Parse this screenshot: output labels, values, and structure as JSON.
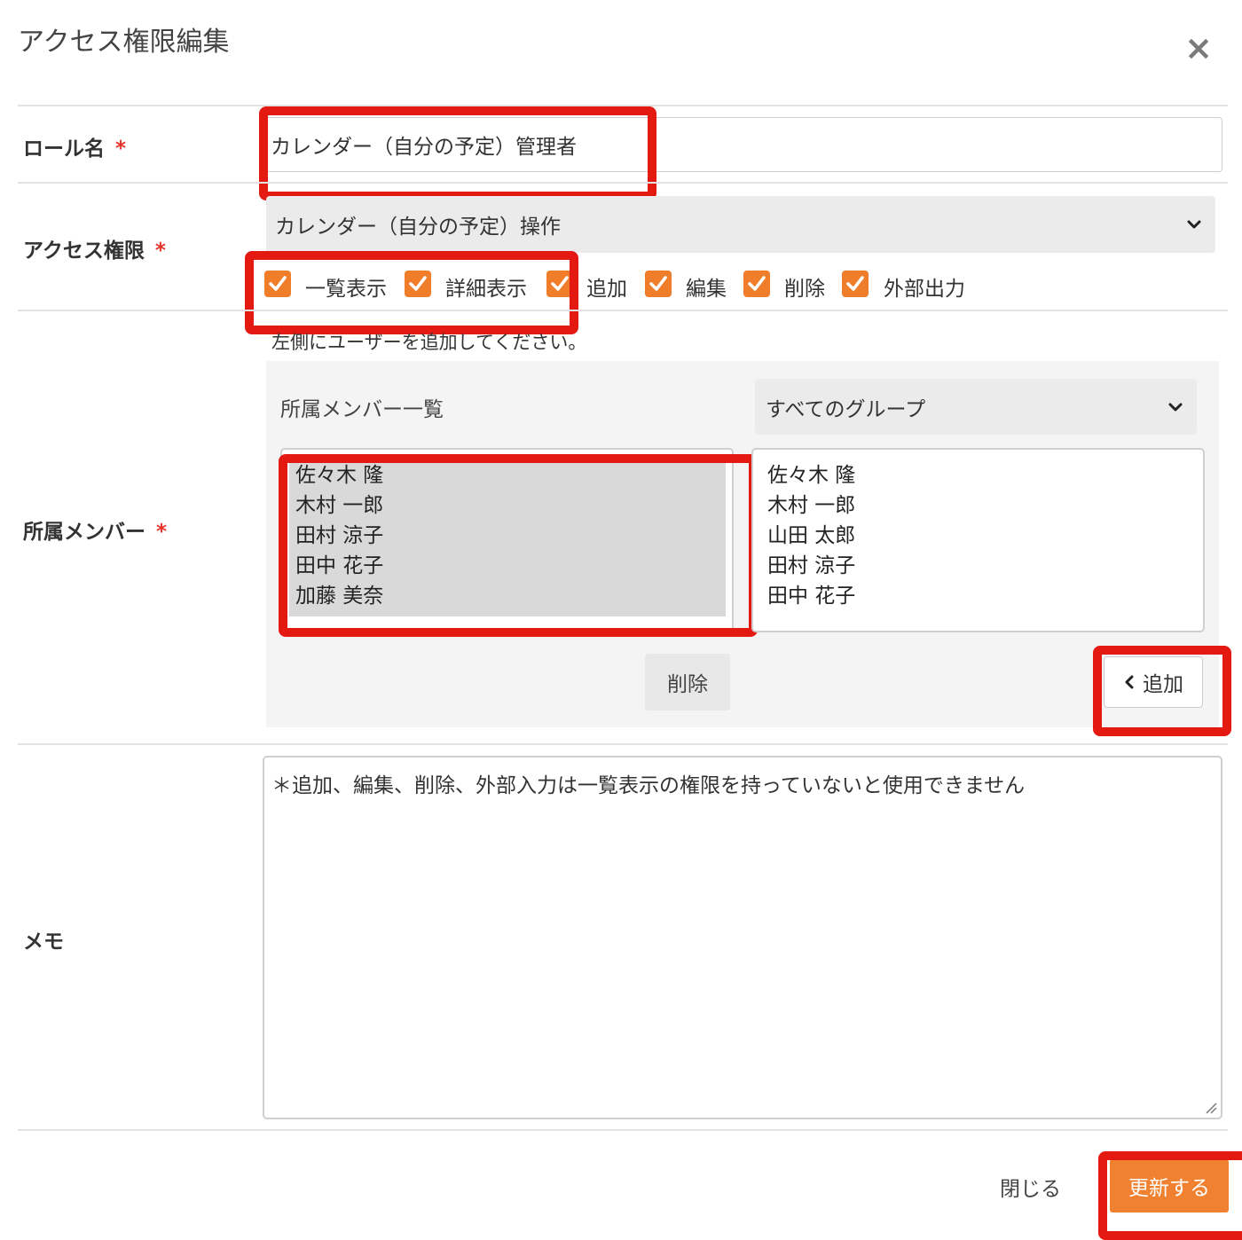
{
  "dialog": {
    "title": "アクセス権限編集",
    "close_icon": "close-icon"
  },
  "role_name": {
    "label": "ロール名",
    "required_mark": "*",
    "value": "カレンダー（自分の予定）管理者"
  },
  "access": {
    "label": "アクセス権限",
    "required_mark": "*",
    "select_value": "カレンダー（自分の予定）操作",
    "permissions": [
      {
        "label": "一覧表示",
        "checked": true
      },
      {
        "label": "詳細表示",
        "checked": true
      },
      {
        "label": "追加",
        "checked": true
      },
      {
        "label": "編集",
        "checked": true
      },
      {
        "label": "削除",
        "checked": true
      },
      {
        "label": "外部出力",
        "checked": true
      }
    ]
  },
  "members": {
    "label": "所属メンバー",
    "required_mark": "*",
    "hint": "左側にユーザーを追加してください。",
    "list_title": "所属メンバー一覧",
    "group_select_value": "すべてのグループ",
    "assigned": [
      "佐々木 隆",
      "木村 一郎",
      "田村 涼子",
      "田中 花子",
      "加藤 美奈"
    ],
    "available": [
      "佐々木 隆",
      "木村 一郎",
      "山田 太郎",
      "田村 涼子",
      "田中 花子"
    ],
    "remove_button": "削除",
    "add_button": "追加"
  },
  "memo": {
    "label": "メモ",
    "value": "＊追加、編集、削除、外部入力は一覧表示の権限を持っていないと使用できません"
  },
  "footer": {
    "close_button": "閉じる",
    "update_button": "更新する"
  },
  "colors": {
    "accent": "#f08131",
    "highlight": "#e41a12",
    "required": "#e5332a"
  }
}
